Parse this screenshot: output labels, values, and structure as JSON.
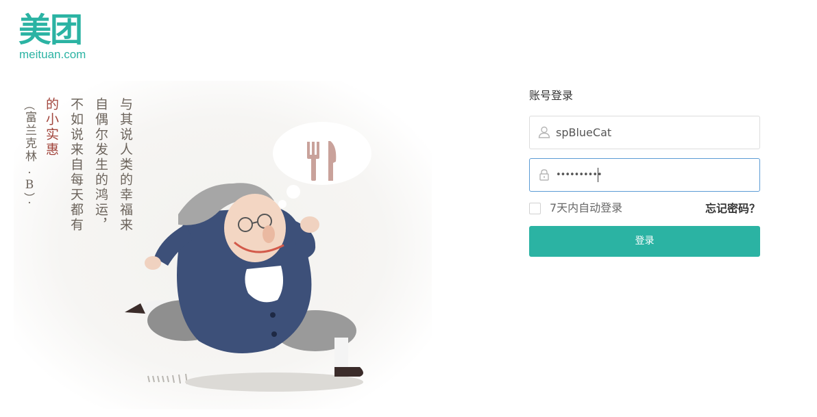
{
  "brand": {
    "logo_cn": "美团",
    "logo_en": "meituan.com",
    "color": "#2bb3a3"
  },
  "illustration": {
    "poem_columns": [
      "与其说人类的幸福来",
      "自偶尔发生的鸿运，",
      "不如说来自每天都有",
      "的小实惠"
    ],
    "credit": "富兰克林.B."
  },
  "login": {
    "title": "账号登录",
    "username_value": "spBlueCat",
    "password_value": "••••••••••",
    "remember_label": "7天内自动登录",
    "forgot_label": "忘记密码？",
    "submit_label": "登录",
    "icons": {
      "username": "user-icon",
      "password": "lock-icon"
    },
    "colors": {
      "button": "#2bb3a3",
      "focus_border": "#5a9bd5"
    }
  }
}
